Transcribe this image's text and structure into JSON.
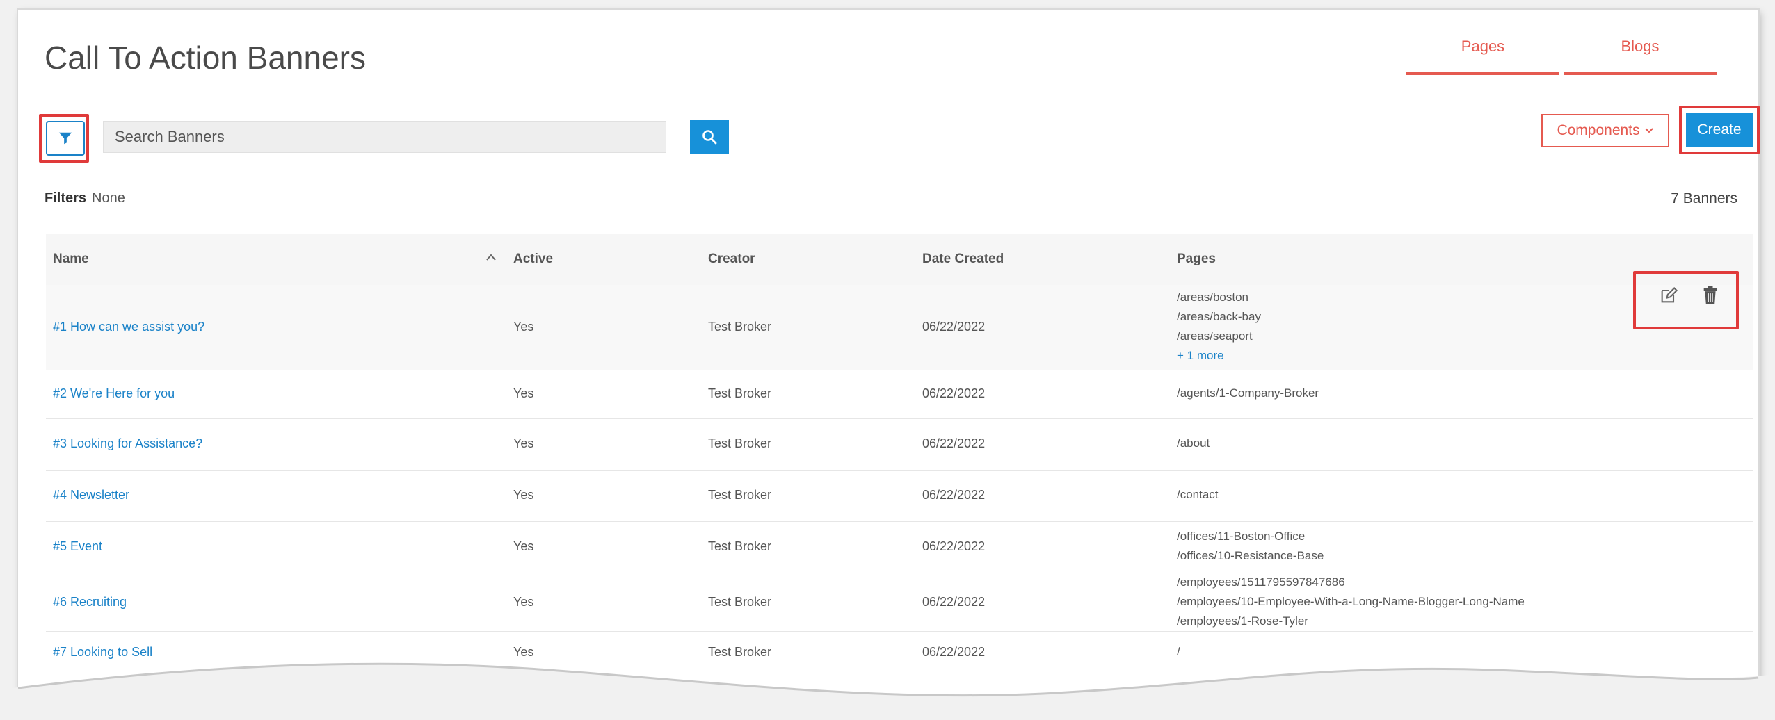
{
  "header": {
    "title": "Call To Action Banners",
    "tabs": [
      {
        "label": "Pages"
      },
      {
        "label": "Blogs"
      }
    ]
  },
  "toolbar": {
    "search_placeholder": "Search Banners",
    "components_label": "Components",
    "create_label": "Create",
    "filter_icon": "filter-icon",
    "search_icon": "search-icon"
  },
  "filters": {
    "label": "Filters",
    "value": "None",
    "count_text": "7 Banners"
  },
  "table": {
    "columns": [
      "Name",
      "Active",
      "Creator",
      "Date Created",
      "Pages"
    ],
    "rows": [
      {
        "name": "#1 How can we assist you?",
        "active": "Yes",
        "creator": "Test Broker",
        "date": "06/22/2022",
        "pages": [
          "/areas/boston",
          "/areas/back-bay",
          "/areas/seaport"
        ],
        "more": "+ 1 more"
      },
      {
        "name": "#2 We're Here for you",
        "active": "Yes",
        "creator": "Test Broker",
        "date": "06/22/2022",
        "pages": [
          "/agents/1-Company-Broker"
        ]
      },
      {
        "name": "#3 Looking for Assistance?",
        "active": "Yes",
        "creator": "Test Broker",
        "date": "06/22/2022",
        "pages": [
          "/about"
        ]
      },
      {
        "name": "#4 Newsletter",
        "active": "Yes",
        "creator": "Test Broker",
        "date": "06/22/2022",
        "pages": [
          "/contact"
        ]
      },
      {
        "name": "#5 Event",
        "active": "Yes",
        "creator": "Test Broker",
        "date": "06/22/2022",
        "pages": [
          "/offices/11-Boston-Office",
          "/offices/10-Resistance-Base"
        ]
      },
      {
        "name": "#6 Recruiting",
        "active": "Yes",
        "creator": "Test Broker",
        "date": "06/22/2022",
        "pages": [
          "/employees/1511795597847686",
          "/employees/10-Employee-With-a-Long-Name-Blogger-Long-Name",
          "/employees/1-Rose-Tyler"
        ]
      },
      {
        "name": "#7 Looking to Sell",
        "active": "Yes",
        "creator": "Test Broker",
        "date": "06/22/2022",
        "pages": [
          "/"
        ]
      }
    ],
    "row_actions": [
      "edit-icon",
      "trash-icon"
    ]
  },
  "colors": {
    "accent_blue": "#1791d9",
    "accent_red": "#e55a50",
    "highlight_red": "#e03a3a"
  }
}
